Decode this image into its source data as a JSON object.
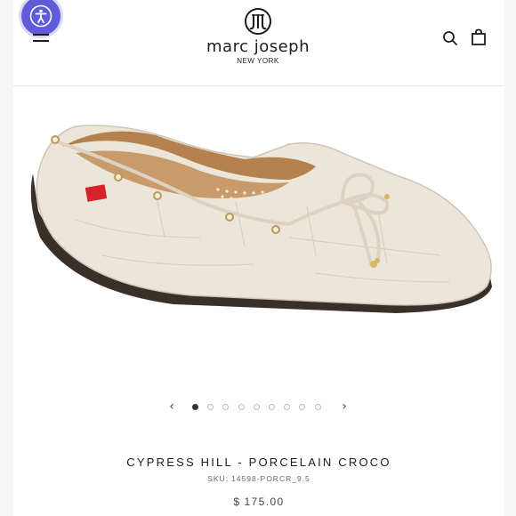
{
  "header": {
    "brand_name": "marc joseph",
    "brand_city": "NEW YORK",
    "icons": {
      "accessibility": "accessibility-icon",
      "menu": "menu-icon",
      "search": "search-icon",
      "bag": "shopping-bag-icon"
    },
    "accessibility_color": "#5f5bd9"
  },
  "product": {
    "title": "CYPRESS HILL - PORCELAIN CROCO",
    "sku_label": "SKU:",
    "sku_value": "14598-PORCR_9.5",
    "price_currency": "$",
    "price_value": "175.00"
  },
  "carousel": {
    "prev": "‹",
    "next": "›",
    "slide_count": 9,
    "active_slide": 1
  },
  "colors": {
    "shoe_body": "#ece5da",
    "accent_tag": "#d4242a",
    "text": "#1c1c1c"
  }
}
